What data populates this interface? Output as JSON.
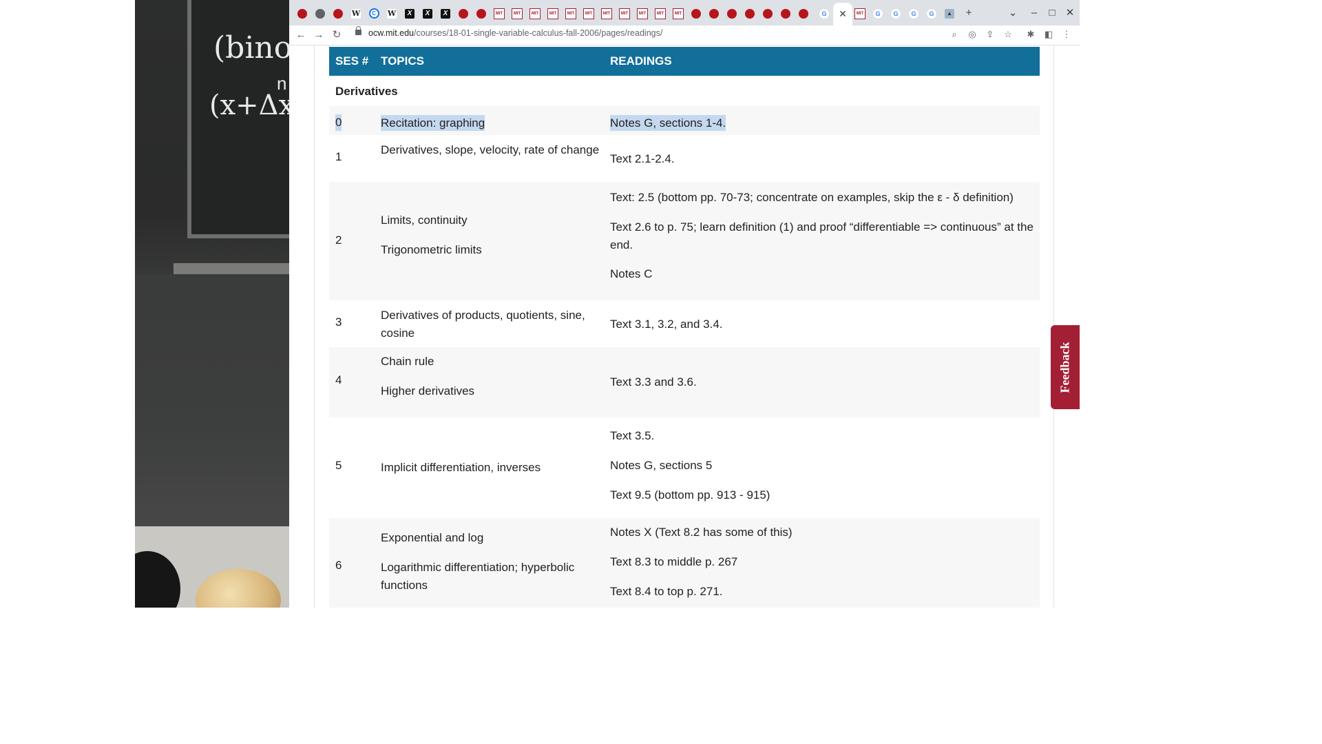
{
  "video": {
    "chalk_line1": "(binom",
    "chalk_line2": "(x+Δx)",
    "chalk_sup": "n"
  },
  "browser": {
    "tabs": [
      {
        "icon": "ocw"
      },
      {
        "icon": "globe"
      },
      {
        "icon": "ocw"
      },
      {
        "icon": "w",
        "glyph": "W"
      },
      {
        "icon": "c",
        "glyph": "C"
      },
      {
        "icon": "w",
        "glyph": "W"
      },
      {
        "icon": "x",
        "glyph": "X"
      },
      {
        "icon": "x",
        "glyph": "X"
      },
      {
        "icon": "x",
        "glyph": "X"
      },
      {
        "icon": "ocw"
      },
      {
        "icon": "ocw"
      },
      {
        "icon": "mit",
        "glyph": "MIT"
      },
      {
        "icon": "mit",
        "glyph": "MIT"
      },
      {
        "icon": "mit",
        "glyph": "MIT"
      },
      {
        "icon": "mit",
        "glyph": "MIT"
      },
      {
        "icon": "mit",
        "glyph": "MIT"
      },
      {
        "icon": "mit",
        "glyph": "MIT"
      },
      {
        "icon": "mit",
        "glyph": "MIT"
      },
      {
        "icon": "mit",
        "glyph": "MIT"
      },
      {
        "icon": "mit",
        "glyph": "MIT"
      },
      {
        "icon": "mit",
        "glyph": "MIT"
      },
      {
        "icon": "mit",
        "glyph": "MIT"
      },
      {
        "icon": "ocw"
      },
      {
        "icon": "ocw"
      },
      {
        "icon": "ocw"
      },
      {
        "icon": "ocw"
      },
      {
        "icon": "ocw"
      },
      {
        "icon": "ocw"
      },
      {
        "icon": "ocw"
      },
      {
        "icon": "g",
        "glyph": "G"
      },
      {
        "icon": "active",
        "glyph": "✕"
      },
      {
        "icon": "mit",
        "glyph": "MIT"
      },
      {
        "icon": "g",
        "glyph": "G"
      },
      {
        "icon": "g",
        "glyph": "G"
      },
      {
        "icon": "g",
        "glyph": "G"
      },
      {
        "icon": "g",
        "glyph": "G"
      },
      {
        "icon": "pic",
        "glyph": "▲"
      }
    ],
    "new_tab_glyph": "+",
    "tab_search_glyph": "⌄",
    "minimize_glyph": "–",
    "maximize_glyph": "□",
    "close_glyph": "✕",
    "url_host": "ocw.mit.edu",
    "url_path": "/courses/18-01-single-variable-calculus-fall-2006/pages/readings/",
    "icons": {
      "back": "←",
      "forward": "→",
      "reload": "↻",
      "zoom": "⌕",
      "media": "◎",
      "share": "⇪",
      "bookmark": "☆",
      "extensions": "✱",
      "sidepanel": "◧",
      "menu": "⋮"
    }
  },
  "table": {
    "headers": {
      "ses": "SES #",
      "topics": "TOPICS",
      "readings": "READINGS"
    },
    "section_title": "Derivatives",
    "rows": [
      {
        "ses": "0",
        "topics": [
          "Recitation: graphing"
        ],
        "readings": [
          "Notes G, sections 1-4."
        ]
      },
      {
        "ses": "1",
        "topics": [
          "Derivatives, slope, velocity, rate of change"
        ],
        "readings": [
          "Text 2.1-2.4."
        ]
      },
      {
        "ses": "2",
        "topics": [
          "Limits, continuity",
          "Trigonometric limits"
        ],
        "readings": [
          "Text: 2.5 (bottom pp. 70-73; concentrate on examples, skip the ε - δ definition)",
          "Text 2.6 to p. 75; learn definition (1) and proof “differentiable => continuous” at the end.",
          "Notes C"
        ]
      },
      {
        "ses": "3",
        "topics": [
          "Derivatives of products, quotients, sine, cosine"
        ],
        "readings": [
          "Text 3.1, 3.2, and 3.4."
        ]
      },
      {
        "ses": "4",
        "topics": [
          "Chain rule",
          "Higher derivatives"
        ],
        "readings": [
          "Text 3.3 and 3.6."
        ]
      },
      {
        "ses": "5",
        "topics": [
          "Implicit differentiation, inverses"
        ],
        "readings": [
          "Text 3.5.",
          "Notes G, sections 5",
          "Text 9.5 (bottom pp. 913 - 915)"
        ]
      },
      {
        "ses": "6",
        "topics": [
          "Exponential and log",
          "Logarithmic differentiation; hyperbolic functions"
        ],
        "readings": [
          "Notes X (Text 8.2 has some of this)",
          "Text 8.3 to middle p. 267",
          "Text 8.4 to top p. 271."
        ]
      }
    ]
  },
  "feedback_label": "Feedback",
  "colors": {
    "header_bg": "#126f9a",
    "feedback_bg": "#a31f34",
    "selection": "#c4d8ef"
  }
}
